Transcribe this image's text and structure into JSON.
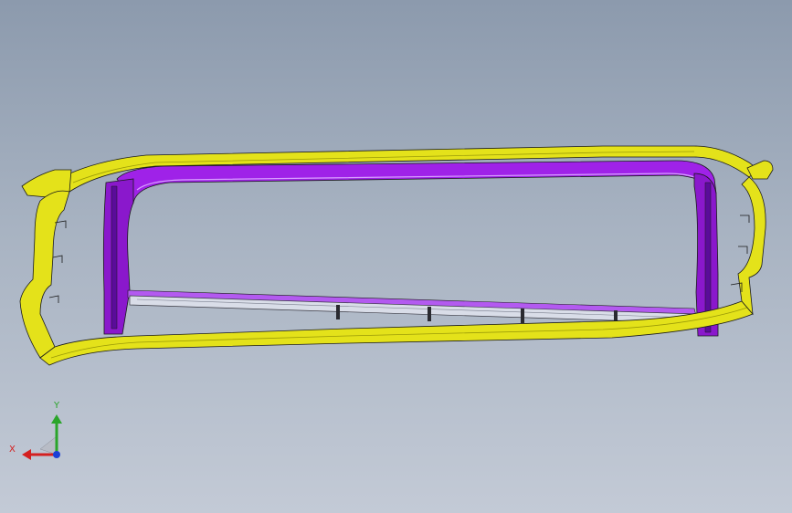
{
  "viewport": {
    "background_top": "#8c9aad",
    "background_bottom": "#c3cad6"
  },
  "model": {
    "name_icon": "grille-frame-assembly",
    "colors": {
      "outer_frame": "#e4e21a",
      "outer_frame_dark": "#9a9a08",
      "inner_frame": "#9f22e8",
      "inner_frame_dark": "#5a0c9a",
      "support_strip": "#d9dde8",
      "edges": "#1a1a1a"
    }
  },
  "triad": {
    "x_label": "X",
    "y_label": "Y",
    "x_color": "#d42020",
    "y_color": "#2aa52a",
    "z_color": "#1a3fd6"
  }
}
